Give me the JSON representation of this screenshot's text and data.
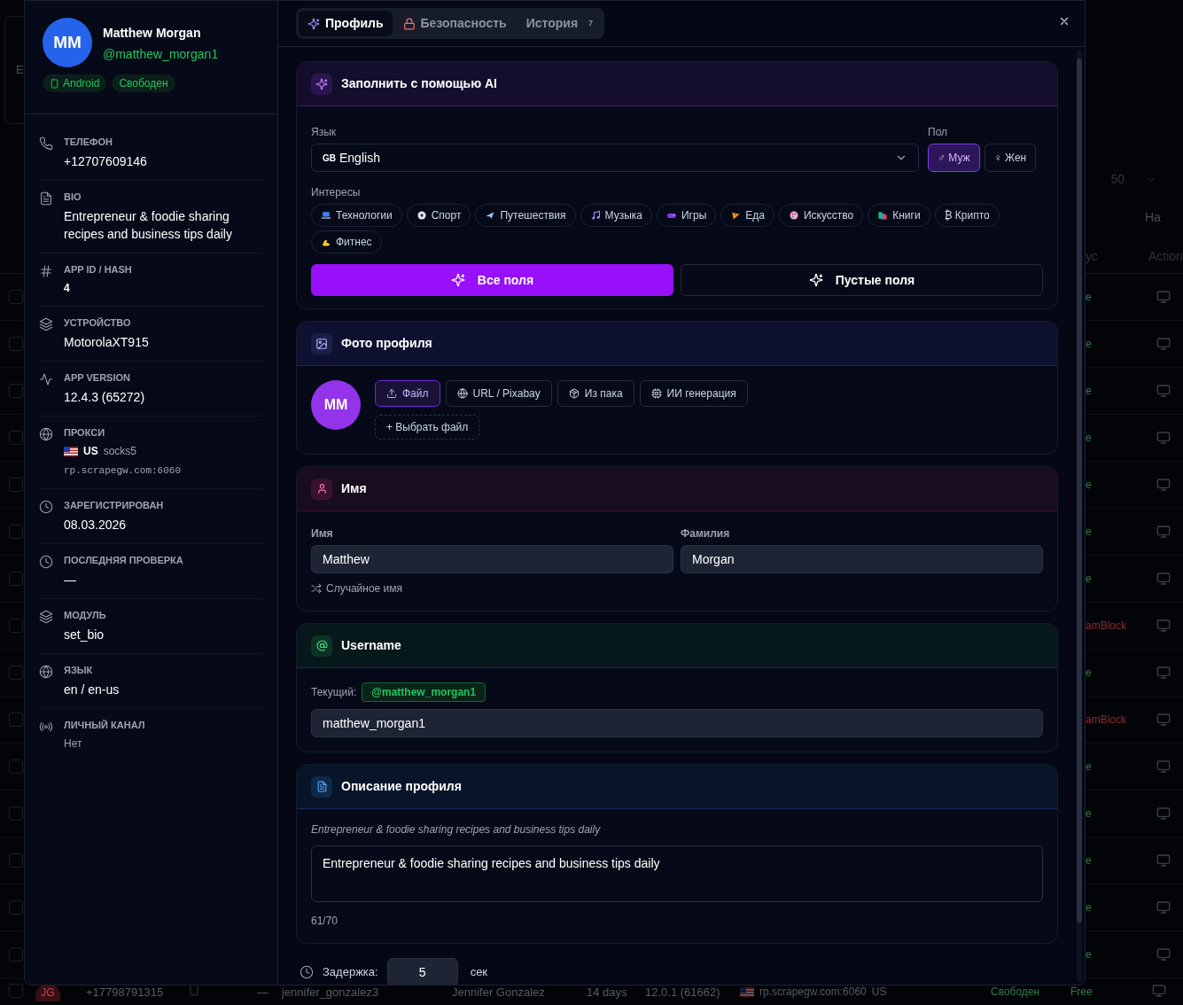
{
  "background": {
    "corner_text": "E",
    "page_size": "50",
    "column_fragment": "Ha",
    "header": {
      "status": "ус",
      "actions": "Action"
    },
    "rows": [
      {
        "checked": false,
        "status": "e",
        "color": "#2f7a4a"
      },
      {
        "checked": false,
        "status": "e",
        "color": "#2f7a4a"
      },
      {
        "checked": false,
        "status": "e",
        "color": "#2f7a4a"
      },
      {
        "checked": false,
        "status": "e",
        "color": "#2f7a4a"
      },
      {
        "checked": false,
        "status": "e",
        "color": "#2f7a4a"
      },
      {
        "checked": false,
        "status": "e",
        "color": "#2f7a4a"
      },
      {
        "checked": false,
        "status": "e",
        "color": "#2f7a4a"
      },
      {
        "checked": false,
        "status": "amBlock",
        "color": "#8a2a36"
      },
      {
        "checked": false,
        "status": "e",
        "color": "#2f7a4a"
      },
      {
        "checked": false,
        "status": "amBlock",
        "color": "#8a2a36"
      },
      {
        "checked": false,
        "status": "e",
        "color": "#2f7a4a"
      },
      {
        "checked": false,
        "status": "e",
        "color": "#2f7a4a"
      },
      {
        "checked": false,
        "status": "e",
        "color": "#2f7a4a"
      },
      {
        "checked": false,
        "status": "e",
        "color": "#2f7a4a"
      },
      {
        "checked": false,
        "status": "e",
        "color": "#2f7a4a"
      }
    ],
    "last_row": {
      "checked": false,
      "initials": "JG",
      "phone": "+17798791315",
      "dash": "—",
      "username": "jennifer_gonzalez3",
      "name": "Jennifer Gonzalez",
      "age": "14 days",
      "version": "12.0.1 (61662)",
      "proxy": "rp.scrapegw.com:6060",
      "country": "US",
      "status": "Свободен",
      "state": "Free"
    }
  },
  "profile": {
    "initials": "MM",
    "name": "Matthew Morgan",
    "username": "@matthew_morgan1",
    "badges": [
      {
        "label": "Android",
        "kind": "platform"
      },
      {
        "label": "Свободен",
        "kind": "status"
      }
    ]
  },
  "details": [
    {
      "kind": "phone",
      "label": "ТЕЛЕФОН",
      "value": "+12707609146"
    },
    {
      "kind": "bio",
      "label": "BIO",
      "value": "Entrepreneur & foodie sharing recipes and business tips daily"
    },
    {
      "kind": "hash",
      "label": "APP ID / HASH",
      "value": "4"
    },
    {
      "kind": "device",
      "label": "УСТРОЙСТВО",
      "value": "MotorolaXT915"
    },
    {
      "kind": "version",
      "label": "APP VERSION",
      "value": "12.4.3 (65272)"
    },
    {
      "kind": "proxy",
      "label": "ПРОКСИ",
      "country": "US",
      "type": "socks5",
      "host": "rp.scrapegw.com:6060"
    },
    {
      "kind": "registered",
      "label": "ЗАРЕГИСТРИРОВАН",
      "value": "08.03.2026"
    },
    {
      "kind": "checked",
      "label": "ПОСЛЕДНЯЯ ПРОВЕРКА",
      "value": "—"
    },
    {
      "kind": "module",
      "label": "МОДУЛЬ",
      "value": "set_bio"
    },
    {
      "kind": "language",
      "label": "ЯЗЫК",
      "value": "en / en-us"
    },
    {
      "kind": "channel",
      "label": "ЛИЧНЫЙ КАНАЛ",
      "value": "Нет"
    }
  ],
  "tabs": [
    {
      "label": "Профиль",
      "kind": "sparkle",
      "selected": true
    },
    {
      "label": "Безопасность",
      "kind": "lock",
      "selected": false
    },
    {
      "label": "История",
      "kind": "plain",
      "count": "7",
      "selected": false
    }
  ],
  "ai_card": {
    "title": "Заполнить с помощью AI",
    "language": {
      "label": "Язык",
      "flag": "GB",
      "value": "English"
    },
    "gender": {
      "label": "Пол",
      "options": [
        {
          "label": "♂ Муж",
          "selected": true
        },
        {
          "label": "♀ Жен",
          "selected": false
        }
      ]
    },
    "interests": {
      "label": "Интересы",
      "items": [
        {
          "label": "Технологии",
          "kind": "laptop"
        },
        {
          "label": "Спорт",
          "kind": "ball"
        },
        {
          "label": "Путешествия",
          "kind": "plane"
        },
        {
          "label": "Музыка",
          "kind": "music"
        },
        {
          "label": "Игры",
          "kind": "gamepad"
        },
        {
          "label": "Еда",
          "kind": "pizza"
        },
        {
          "label": "Искусство",
          "kind": "palette"
        },
        {
          "label": "Книги",
          "kind": "books"
        },
        {
          "label": "₿ Крипто",
          "kind": "plain"
        },
        {
          "label": "Фитнес",
          "kind": "muscle"
        }
      ]
    },
    "buttons": [
      {
        "label": "Все поля",
        "kind": "primary"
      },
      {
        "label": "Пустые поля",
        "kind": "outline"
      }
    ]
  },
  "photo_card": {
    "title": "Фото профиля",
    "initials": "MM",
    "sources": [
      {
        "label": "Файл",
        "kind": "file",
        "selected": true
      },
      {
        "label": "URL / Pixabay",
        "kind": "url",
        "selected": false
      },
      {
        "label": "Из пака",
        "kind": "pack",
        "selected": false
      },
      {
        "label": "ИИ генерация",
        "kind": "ai",
        "selected": false
      }
    ],
    "pick_button": "+ Выбрать файл"
  },
  "name_card": {
    "title": "Имя",
    "first_name": {
      "label": "Имя",
      "value": "Matthew"
    },
    "last_name": {
      "label": "Фамилия",
      "value": "Morgan"
    },
    "random_link": "Случайное имя"
  },
  "username_card": {
    "title": "Username",
    "current_label": "Текущий:",
    "current": "@matthew_morgan1",
    "value": "matthew_morgan1"
  },
  "bio_card": {
    "title": "Описание профиля",
    "preview": "Entrepreneur & foodie sharing recipes and business tips daily",
    "value": "Entrepreneur & foodie sharing recipes and business tips daily",
    "counter": "61/70"
  },
  "delay": {
    "label": "Задержка:",
    "value": "5",
    "unit": "сек"
  }
}
